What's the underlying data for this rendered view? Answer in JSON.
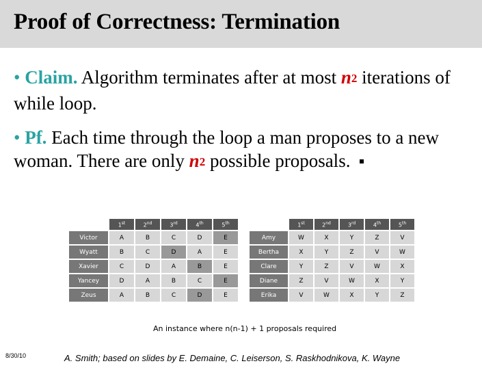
{
  "title": "Proof of Correctness: Termination",
  "claim": {
    "bullet": "•",
    "keyword": "Claim.",
    "text": " Algorithm terminates after at most ",
    "n": "n",
    "exp": "2",
    "tail": " iterations of while loop."
  },
  "proof": {
    "bullet": "•",
    "keyword": "Pf.",
    "text": "  Each time through the loop a man proposes to a new woman. There are only ",
    "n": "n",
    "exp": "2",
    "tail": " possible proposals."
  },
  "men_table": {
    "headers": [
      {
        "n": "1",
        "suf": "st"
      },
      {
        "n": "2",
        "suf": "nd"
      },
      {
        "n": "3",
        "suf": "rd"
      },
      {
        "n": "4",
        "suf": "th"
      },
      {
        "n": "5",
        "suf": "th"
      }
    ],
    "rows": [
      {
        "name": "Victor",
        "prefs": [
          "A",
          "B",
          "C",
          "D",
          "E"
        ]
      },
      {
        "name": "Wyatt",
        "prefs": [
          "B",
          "C",
          "D",
          "A",
          "E"
        ]
      },
      {
        "name": "Xavier",
        "prefs": [
          "C",
          "D",
          "A",
          "B",
          "E"
        ]
      },
      {
        "name": "Yancey",
        "prefs": [
          "D",
          "A",
          "B",
          "C",
          "E"
        ]
      },
      {
        "name": "Zeus",
        "prefs": [
          "A",
          "B",
          "C",
          "D",
          "E"
        ]
      }
    ]
  },
  "women_table": {
    "headers": [
      {
        "n": "1",
        "suf": "st"
      },
      {
        "n": "2",
        "suf": "nd"
      },
      {
        "n": "3",
        "suf": "rd"
      },
      {
        "n": "4",
        "suf": "th"
      },
      {
        "n": "5",
        "suf": "th"
      }
    ],
    "rows": [
      {
        "name": "Amy",
        "prefs": [
          "W",
          "X",
          "Y",
          "Z",
          "V"
        ]
      },
      {
        "name": "Bertha",
        "prefs": [
          "X",
          "Y",
          "Z",
          "V",
          "W"
        ]
      },
      {
        "name": "Clare",
        "prefs": [
          "Y",
          "Z",
          "V",
          "W",
          "X"
        ]
      },
      {
        "name": "Diane",
        "prefs": [
          "Z",
          "V",
          "W",
          "X",
          "Y"
        ]
      },
      {
        "name": "Erika",
        "prefs": [
          "V",
          "W",
          "X",
          "Y",
          "Z"
        ]
      }
    ]
  },
  "caption": "An instance where n(n-1) + 1 proposals required",
  "date": "8/30/10",
  "credit": "A. Smith; based on slides by E. Demaine, C. Leiserson, S. Raskhodnikova, K. Wayne"
}
